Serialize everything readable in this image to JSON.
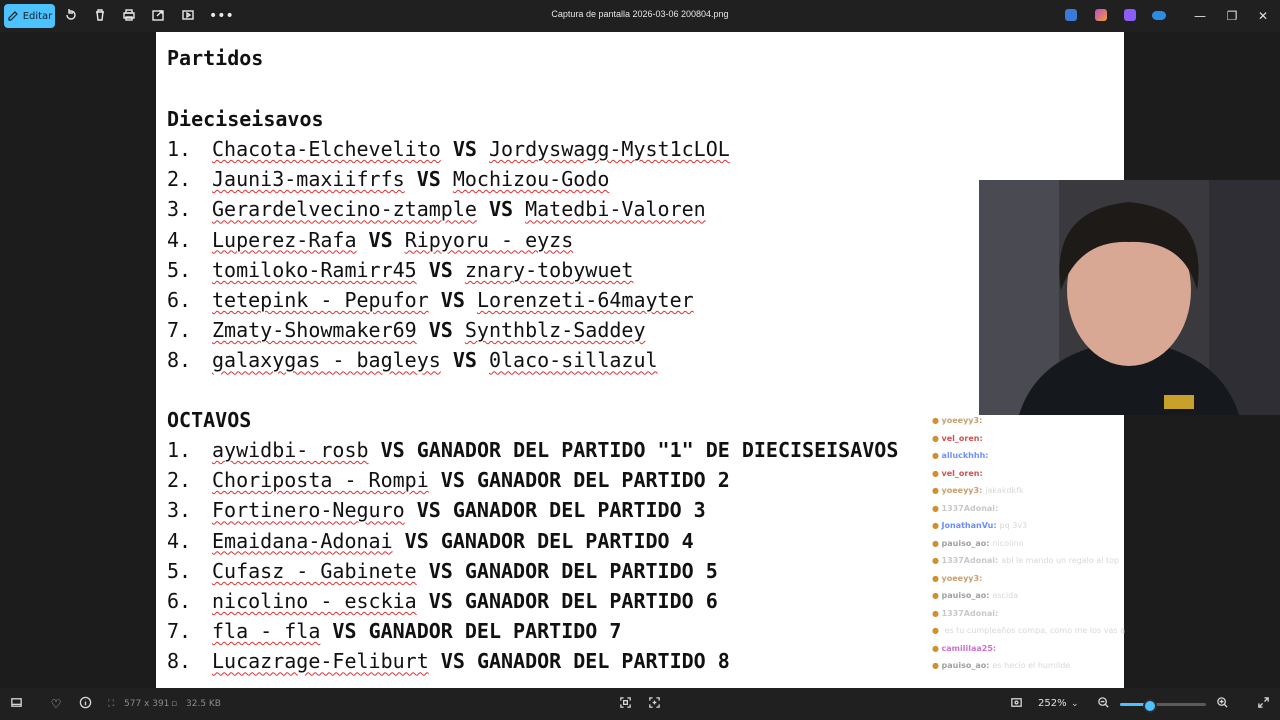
{
  "window": {
    "title": "Captura de pantalla 2026-03-06 200804.png"
  },
  "toolbar": {
    "edit_label": "Editar"
  },
  "document": {
    "heading": "Partidos",
    "section1_title": "Dieciseisavos",
    "section2_title": "OCTAVOS",
    "vs": "VS",
    "dieciseisavos": [
      {
        "num": "1.",
        "a": "Chacota-Elchevelito",
        "b": "Jordyswagg-Myst1cLOL"
      },
      {
        "num": "2.",
        "a": "Jauni3-maxiifrfs",
        "b": "Mochizou-Godo"
      },
      {
        "num": "3.",
        "a": "Gerardelvecino-ztample",
        "b": "Matedbi-Valoren"
      },
      {
        "num": "4.",
        "a": "Luperez-Rafa",
        "b": "Ripyoru - eyzs"
      },
      {
        "num": "5.",
        "a": "tomiloko-Ramirr45",
        "b": "znary-tobywuet"
      },
      {
        "num": "6.",
        "a": "tetepink - Pepufor",
        "b": "Lorenzeti-64mayter"
      },
      {
        "num": "7.",
        "a": "Zmaty-Showmaker69",
        "b": "Synthblz-Saddey"
      },
      {
        "num": "8.",
        "a": "galaxygas - bagleys",
        "b": "0laco-sillazul"
      }
    ],
    "octavos": [
      {
        "num": "1.",
        "a": "aywidbi- rosb",
        "b": "GANADOR DEL PARTIDO \"1\" DE DIECISEISAVOS"
      },
      {
        "num": "2.",
        "a": "Choriposta - Rompi",
        "b": "GANADOR DEL PARTIDO 2"
      },
      {
        "num": "3.",
        "a": "Fortinero-Neguro",
        "b": "GANADOR DEL PARTIDO 3"
      },
      {
        "num": "4.",
        "a": "Emaidana-Adonai",
        "b": "GANADOR DEL PARTIDO 4"
      },
      {
        "num": "5.",
        "a": "Cufasz - Gabinete",
        "b": "GANADOR DEL PARTIDO 5"
      },
      {
        "num": "6.",
        "a": "nicolino - esckia",
        "b": "GANADOR DEL PARTIDO 6"
      },
      {
        "num": "7.",
        "a": "fla - fla",
        "b": "GANADOR DEL PARTIDO 7"
      },
      {
        "num": "8.",
        "a": "Lucazrage-Feliburt",
        "b": "GANADOR DEL PARTIDO 8"
      }
    ]
  },
  "chat": [
    {
      "user": "yoeeyy3:",
      "msg": "",
      "color": "#c8a070"
    },
    {
      "user": "vel_oren:",
      "msg": "",
      "color": "#d05050"
    },
    {
      "user": "alluckhhh:",
      "msg": "",
      "color": "#7090ff"
    },
    {
      "user": "vel_oren:",
      "msg": "",
      "color": "#d05050"
    },
    {
      "user": "yoeeyy3:",
      "msg": "jakakdkfk",
      "color": "#c8a070"
    },
    {
      "user": "1337Adonai:",
      "msg": "",
      "color": "#c8c8c8"
    },
    {
      "user": "JonathanVu:",
      "msg": "pq 3v3",
      "color": "#6a8cff"
    },
    {
      "user": "pauiso_ao:",
      "msg": "nicolino",
      "color": "#a0a0a0"
    },
    {
      "user": "1337Adonai:",
      "msg": "abl le mando un regalo al top",
      "color": "#c8c8c8"
    },
    {
      "user": "yoeeyy3:",
      "msg": "",
      "color": "#c8a070"
    },
    {
      "user": "pauiso_ao:",
      "msg": "escida",
      "color": "#a0a0a0"
    },
    {
      "user": "1337Adonai:",
      "msg": "",
      "color": "#c8c8c8"
    },
    {
      "user": "",
      "msg": "es tu cumpleaños compa, como me los vas a devolver",
      "color": "#c8c8c8"
    },
    {
      "user": "camililaa25:",
      "msg": "",
      "color": "#d070d0"
    },
    {
      "user": "pauiso_ao:",
      "msg": "es hecio el humilde",
      "color": "#a0a0a0"
    }
  ],
  "statusbar": {
    "dimensions": "577 x 391",
    "filesize": "32.5 KB",
    "zoom": "252%",
    "zoom_level": 0.35
  },
  "colors": {
    "accent": "#4cc2ff",
    "topbar": "#202020",
    "background": "#1c1c1c"
  }
}
